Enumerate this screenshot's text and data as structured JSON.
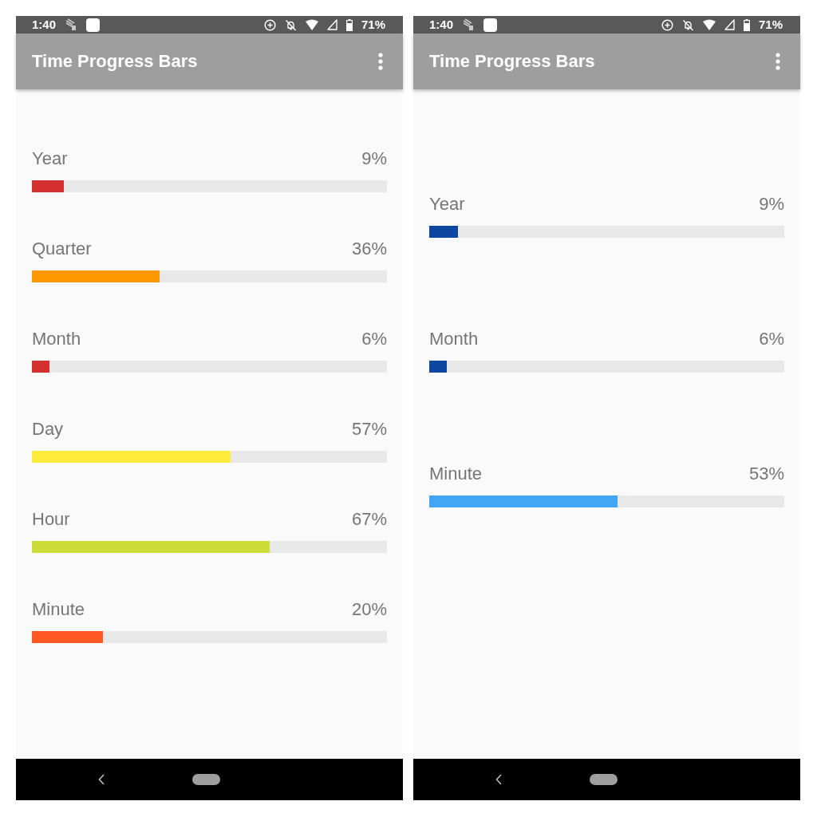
{
  "screens": [
    {
      "status_bar": {
        "time": "1:40",
        "battery": "71%"
      },
      "app_bar": {
        "title": "Time Progress Bars"
      },
      "progress_bars": [
        {
          "label": "Year",
          "percent": "9%",
          "level": 0.09,
          "color": "#d32f2f"
        },
        {
          "label": "Quarter",
          "percent": "36%",
          "level": 0.36,
          "color": "#ff9800"
        },
        {
          "label": "Month",
          "percent": "6%",
          "level": 0.05,
          "color": "#d32f2f"
        },
        {
          "label": "Day",
          "percent": "57%",
          "level": 0.56,
          "color": "#ffeb3b"
        },
        {
          "label": "Hour",
          "percent": "67%",
          "level": 0.67,
          "color": "#cddc39"
        },
        {
          "label": "Minute",
          "percent": "20%",
          "level": 0.2,
          "color": "#ff5722"
        }
      ]
    },
    {
      "status_bar": {
        "time": "1:40",
        "battery": "71%"
      },
      "app_bar": {
        "title": "Time Progress Bars"
      },
      "progress_bars": [
        {
          "label": "Year",
          "percent": "9%",
          "level": 0.08,
          "color": "#0d47a1"
        },
        {
          "label": "Month",
          "percent": "6%",
          "level": 0.05,
          "color": "#0d47a1"
        },
        {
          "label": "Minute",
          "percent": "53%",
          "level": 0.53,
          "color": "#42a5f5"
        }
      ]
    }
  ]
}
